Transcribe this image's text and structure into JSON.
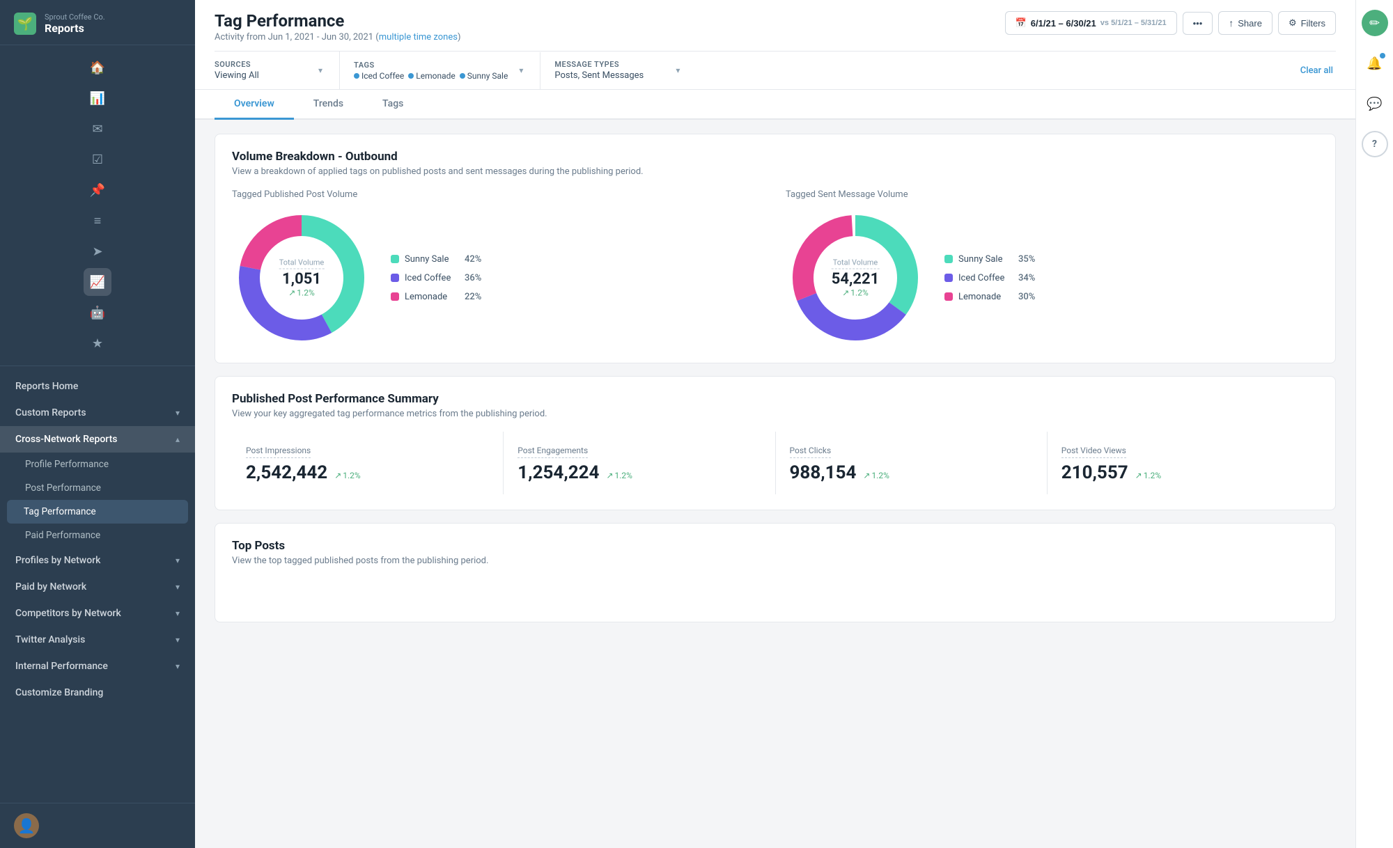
{
  "company": "Sprout Coffee Co.",
  "app_title": "Reports",
  "sidebar": {
    "nav_items": [
      {
        "id": "reports-home",
        "label": "Reports Home",
        "expandable": false
      },
      {
        "id": "custom-reports",
        "label": "Custom Reports",
        "expandable": true
      },
      {
        "id": "cross-network-reports",
        "label": "Cross-Network Reports",
        "expandable": true,
        "expanded": true
      }
    ],
    "sub_items": [
      {
        "id": "profile-performance",
        "label": "Profile Performance",
        "active": false
      },
      {
        "id": "post-performance",
        "label": "Post Performance",
        "active": false
      },
      {
        "id": "tag-performance",
        "label": "Tag Performance",
        "active": true
      },
      {
        "id": "paid-performance",
        "label": "Paid Performance",
        "active": false
      }
    ],
    "section_items": [
      {
        "id": "profiles-by-network",
        "label": "Profiles by Network",
        "expandable": true
      },
      {
        "id": "paid-by-network",
        "label": "Paid by Network",
        "expandable": true
      },
      {
        "id": "competitors-by-network",
        "label": "Competitors by Network",
        "expandable": true
      },
      {
        "id": "twitter-analysis",
        "label": "Twitter Analysis",
        "expandable": true
      },
      {
        "id": "internal-performance",
        "label": "Internal Performance",
        "expandable": true
      }
    ],
    "footer_item": "Customize Branding"
  },
  "header": {
    "title": "Tag Performance",
    "subtitle": "Activity from Jun 1, 2021 - Jun 30, 2021",
    "subtitle_link": "multiple time zones",
    "date_range": "6/1/21 – 6/30/21",
    "vs_range": "vs 5/1/21 – 5/31/21",
    "share_label": "Share",
    "filters_label": "Filters"
  },
  "filters": {
    "sources_label": "Sources",
    "sources_value": "Viewing All",
    "tags_label": "Tags",
    "tags": [
      {
        "name": "Iced Coffee",
        "color": "#3b97d3"
      },
      {
        "name": "Lemonade",
        "color": "#3b97d3"
      },
      {
        "name": "Sunny Sale",
        "color": "#3b97d3"
      }
    ],
    "message_types_label": "Message Types",
    "message_types_value": "Posts, Sent Messages",
    "clear_all_label": "Clear all"
  },
  "tabs": [
    {
      "id": "overview",
      "label": "Overview",
      "active": true
    },
    {
      "id": "trends",
      "label": "Trends",
      "active": false
    },
    {
      "id": "tags",
      "label": "Tags",
      "active": false
    }
  ],
  "volume_breakdown": {
    "title": "Volume Breakdown - Outbound",
    "subtitle": "View a breakdown of applied tags on published posts and sent messages during the publishing period.",
    "published_label": "Tagged Published Post Volume",
    "sent_label": "Tagged Sent Message Volume",
    "published_chart": {
      "center_label": "Total Volume",
      "center_value": "1,051",
      "change": "1.2%",
      "segments": [
        {
          "name": "Sunny Sale",
          "pct": 42,
          "color": "#4cdbbb",
          "start_angle": 0,
          "end_angle": 151.2
        },
        {
          "name": "Iced Coffee",
          "pct": 36,
          "color": "#6c5ce7",
          "start_angle": 151.2,
          "end_angle": 280.8
        },
        {
          "name": "Lemonade",
          "pct": 22,
          "color": "#e84393",
          "start_angle": 280.8,
          "end_angle": 360
        }
      ]
    },
    "sent_chart": {
      "center_label": "Total Volume",
      "center_value": "54,221",
      "change": "1.2%",
      "segments": [
        {
          "name": "Sunny Sale",
          "pct": 35,
          "color": "#4cdbbb",
          "start_angle": 0,
          "end_angle": 126
        },
        {
          "name": "Iced Coffee",
          "pct": 34,
          "color": "#6c5ce7",
          "start_angle": 126,
          "end_angle": 248.4
        },
        {
          "name": "Lemonade",
          "pct": 30,
          "color": "#e84393",
          "start_angle": 248.4,
          "end_angle": 360
        }
      ]
    }
  },
  "published_summary": {
    "title": "Published Post Performance Summary",
    "subtitle": "View your key aggregated tag performance metrics from the publishing period.",
    "stats": [
      {
        "name": "Post Impressions",
        "value": "2,542,442",
        "change": "1.2%"
      },
      {
        "name": "Post Engagements",
        "value": "1,254,224",
        "change": "1.2%"
      },
      {
        "name": "Post Clicks",
        "value": "988,154",
        "change": "1.2%"
      },
      {
        "name": "Post Video Views",
        "value": "210,557",
        "change": "1.2%"
      }
    ]
  },
  "top_posts": {
    "title": "Top Posts",
    "subtitle": "View the top tagged published posts from the publishing period."
  },
  "icons": {
    "logo": "🌱",
    "calendar": "📅",
    "share": "↑",
    "filter": "⚙",
    "more": "•••",
    "chevron_down": "▾",
    "chevron_right": "›",
    "arrow_up": "↗",
    "bell": "🔔",
    "comment": "💬",
    "help": "?",
    "edit": "✏",
    "grid": "▦",
    "list": "≡",
    "send": "➤",
    "pin": "📌",
    "chart": "📊",
    "star": "★"
  },
  "colors": {
    "teal": "#4cdbbb",
    "purple": "#6c5ce7",
    "pink": "#e84393",
    "blue": "#3b97d3",
    "green": "#4caf7d",
    "sidebar_bg": "#2c3e50"
  }
}
